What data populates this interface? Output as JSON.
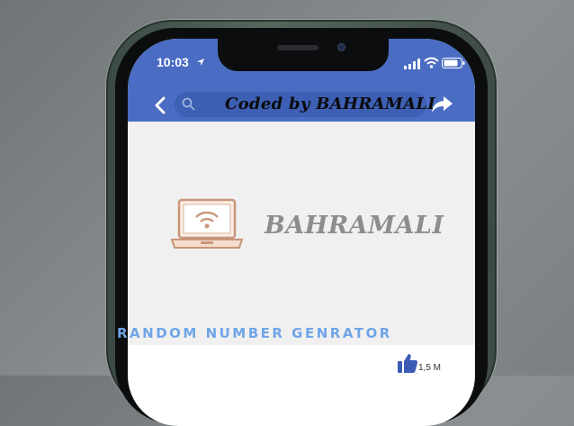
{
  "status_bar": {
    "time": "10:03",
    "icons": [
      "location-arrow-icon",
      "signal-bars-icon",
      "wifi-icon",
      "battery-icon"
    ]
  },
  "header": {
    "back_icon": "chevron-left-icon",
    "search_icon": "search-icon",
    "search_text": "Coded by BAHRAMALI",
    "share_icon": "share-arrow-icon"
  },
  "content": {
    "logo_icon": "laptop-wifi-icon",
    "brand_name": "BAHRAMALI"
  },
  "app": {
    "title": "RANDOM NUMBER GENRATOR",
    "like_icon": "thumbs-up-icon",
    "like_count": "1,5 M"
  },
  "colors": {
    "header_blue": "#4a6cc2",
    "search_bar": "#3d5fb4",
    "title_blue": "#6fa5e8",
    "logo_copper": "#c9967a",
    "like_blue": "#3b5bb5"
  }
}
